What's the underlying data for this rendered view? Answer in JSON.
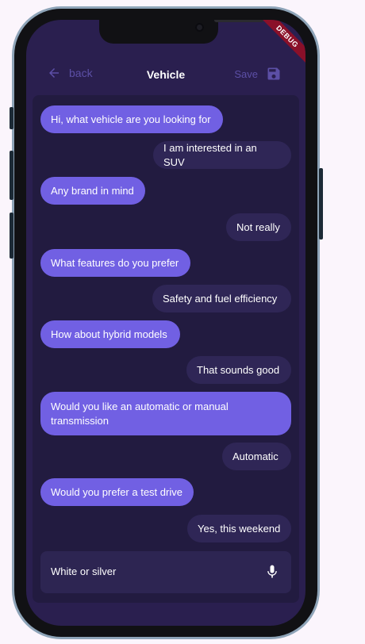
{
  "app_bar": {
    "back_label": "back",
    "title": "Vehicle",
    "save_label": "Save"
  },
  "debug_banner": "DEBUG",
  "messages": [
    {
      "sender": "bot",
      "text": "Hi, what vehicle are you looking for"
    },
    {
      "sender": "user",
      "text": "I am interested in an SUV"
    },
    {
      "sender": "bot",
      "text": "Any brand in mind"
    },
    {
      "sender": "user",
      "text": "Not really"
    },
    {
      "sender": "bot",
      "text": "What features do you prefer"
    },
    {
      "sender": "user",
      "text": "Safety and fuel efficiency"
    },
    {
      "sender": "bot",
      "text": "How about hybrid models"
    },
    {
      "sender": "user",
      "text": "That sounds good"
    },
    {
      "sender": "bot",
      "text": "Would you like an automatic or manual transmission"
    },
    {
      "sender": "user",
      "text": "Automatic"
    },
    {
      "sender": "bot",
      "text": "Would you prefer a test drive"
    },
    {
      "sender": "user",
      "text": "Yes, this weekend"
    }
  ],
  "input": {
    "value": "White or silver",
    "mic_icon": "mic-icon"
  },
  "colors": {
    "background": "#2a1f4f",
    "chat_panel": "#221b40",
    "bot_bubble": "#7160e3",
    "user_bubble": "#2f2656",
    "muted_accent": "#5c4fa6"
  }
}
